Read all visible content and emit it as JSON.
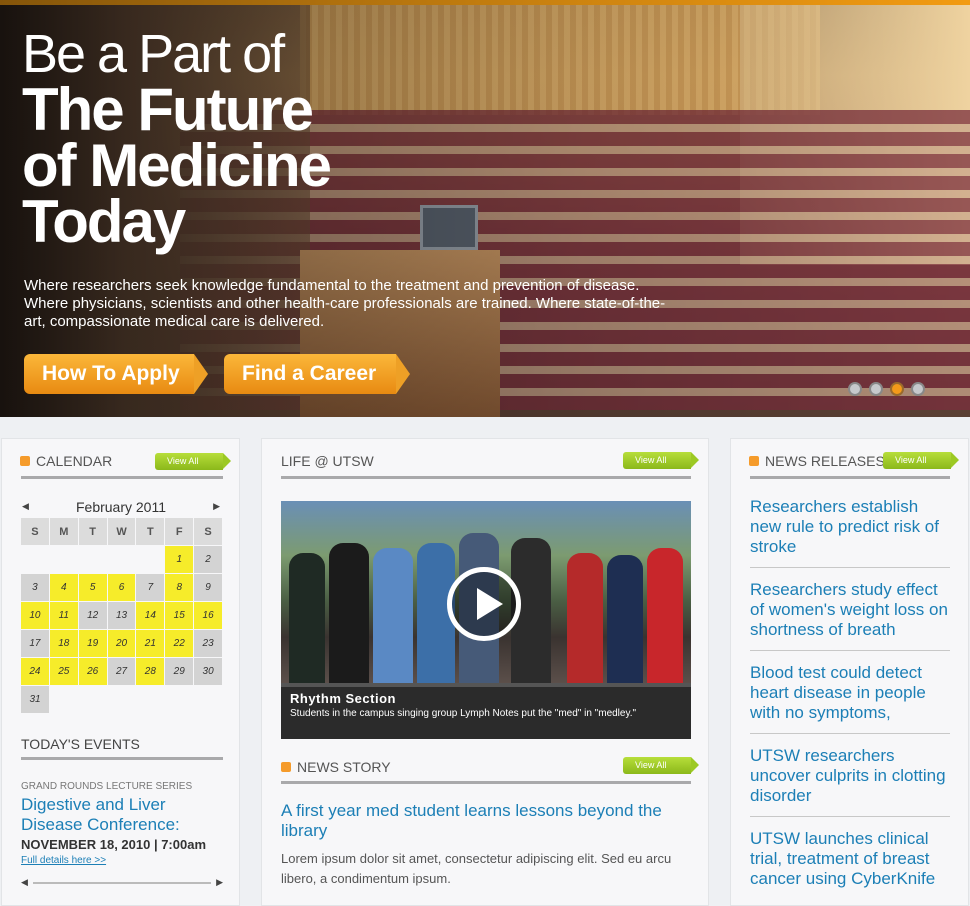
{
  "hero": {
    "headline_line1": "Be a Part of",
    "headline_line2": "The Future",
    "headline_line3": "of Medicine",
    "headline_line4": "Today",
    "description": "Where researchers seek knowledge fundamental to the treatment and prevention of disease. Where physicians, scientists and other health-care professionals are trained. Where state-of-the-art, compassionate medical care is delivered.",
    "apply_label": "How To Apply",
    "career_label": "Find a Career",
    "slides": 4,
    "active_slide": 3,
    "accent": "#f29b12"
  },
  "calendar": {
    "title": "CALENDAR",
    "view_all": "View All",
    "month": "February 2011",
    "prev": "◀",
    "next": "▶",
    "weekdays": [
      "S",
      "M",
      "T",
      "W",
      "T",
      "F",
      "S"
    ],
    "days": [
      [
        {
          "d": "",
          "c": "e"
        },
        {
          "d": "",
          "c": "e"
        },
        {
          "d": "",
          "c": "e"
        },
        {
          "d": "",
          "c": "e"
        },
        {
          "d": "",
          "c": "e"
        },
        {
          "d": "1",
          "c": "y"
        },
        {
          "d": "2",
          "c": "g"
        }
      ],
      [
        {
          "d": "3",
          "c": "g"
        },
        {
          "d": "4",
          "c": "y"
        },
        {
          "d": "5",
          "c": "y"
        },
        {
          "d": "6",
          "c": "y"
        },
        {
          "d": "7",
          "c": "g"
        },
        {
          "d": "8",
          "c": "y"
        },
        {
          "d": "9",
          "c": "g"
        }
      ],
      [
        {
          "d": "10",
          "c": "y"
        },
        {
          "d": "11",
          "c": "y"
        },
        {
          "d": "12",
          "c": "g"
        },
        {
          "d": "13",
          "c": "g"
        },
        {
          "d": "14",
          "c": "y"
        },
        {
          "d": "15",
          "c": "y"
        },
        {
          "d": "16",
          "c": "y"
        }
      ],
      [
        {
          "d": "17",
          "c": "g"
        },
        {
          "d": "18",
          "c": "y"
        },
        {
          "d": "19",
          "c": "y"
        },
        {
          "d": "20",
          "c": "y"
        },
        {
          "d": "21",
          "c": "y"
        },
        {
          "d": "22",
          "c": "y"
        },
        {
          "d": "23",
          "c": "g"
        }
      ],
      [
        {
          "d": "24",
          "c": "y"
        },
        {
          "d": "25",
          "c": "y"
        },
        {
          "d": "26",
          "c": "y"
        },
        {
          "d": "27",
          "c": "g"
        },
        {
          "d": "28",
          "c": "y"
        },
        {
          "d": "29",
          "c": "g"
        },
        {
          "d": "30",
          "c": "g"
        }
      ],
      [
        {
          "d": "31",
          "c": "g"
        }
      ]
    ],
    "events_title": "TODAY'S EVENTS",
    "event_series": "GRAND ROUNDS LECTURE SERIES",
    "event_title": "Digestive and Liver Disease Conference:",
    "event_date": "NOVEMBER 18, 2010 | 7:00am",
    "event_link": "Full details here >>",
    "scroll_left": "◀",
    "scroll_right": "▶",
    "yellow": "#f6ec2a"
  },
  "life": {
    "title": "LIFE @ UTSW",
    "view_all": "View All",
    "video_title": "Rhythm Section",
    "video_caption": "Students in the campus singing group Lymph Notes put the \"med\" in \"medley.\"",
    "play_icon": "play-icon",
    "news_title": "NEWS STORY",
    "news_view_all": "View All",
    "news_headline": "A first year med student learns lessons beyond the library",
    "news_body": "Lorem ipsum dolor sit amet, consectetur adipiscing elit. Sed eu arcu libero, a condimentum ipsum."
  },
  "news": {
    "title": "NEWS RELEASES",
    "view_all": "View All",
    "items": [
      "Researchers establish new rule to predict risk of stroke",
      "Researchers study effect of women's weight loss on shortness of breath",
      "Blood test could detect heart disease in people with no symptoms,",
      "UTSW researchers uncover culprits in clotting disorder",
      "UTSW launches clinical trial, treatment of breast cancer using CyberKnife"
    ],
    "link_color": "#1c7fb6"
  }
}
